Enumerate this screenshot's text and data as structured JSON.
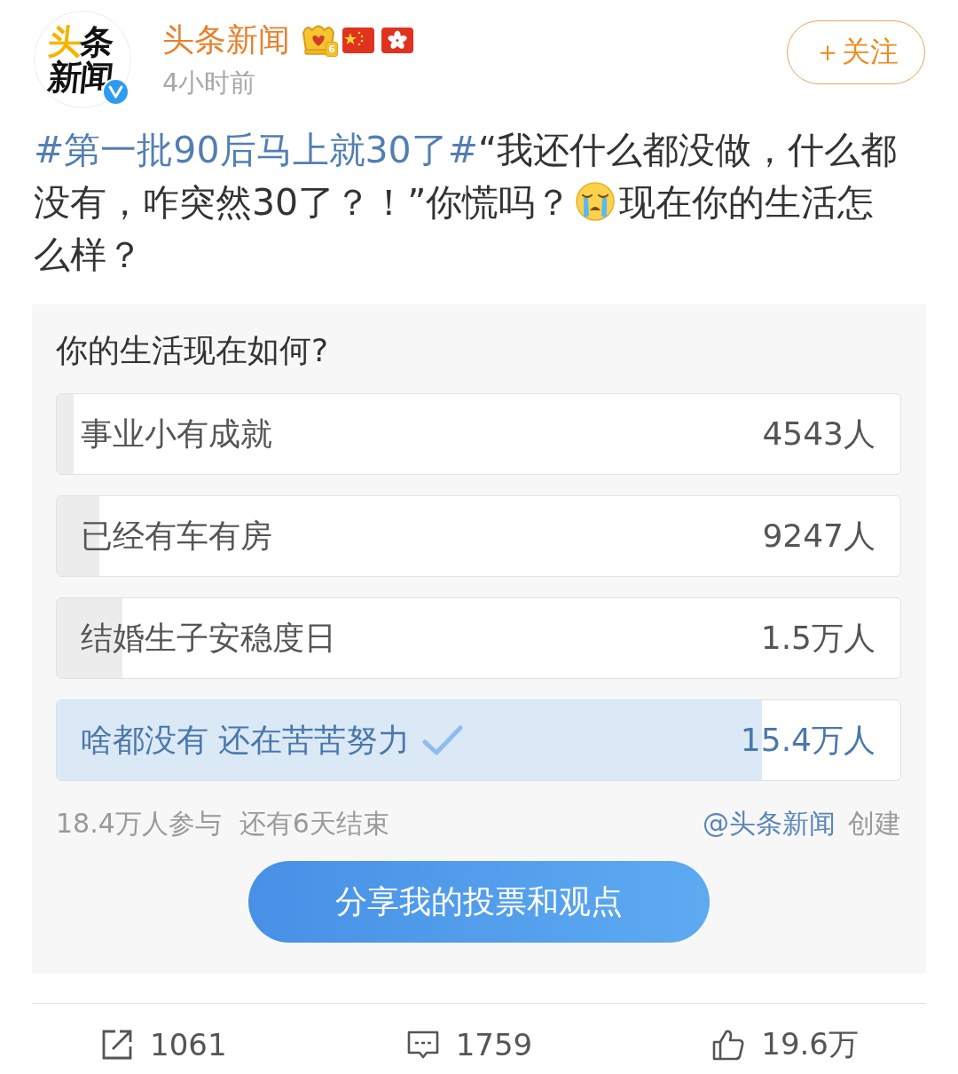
{
  "author": {
    "avatar_logo": [
      "头条",
      "新闻"
    ],
    "verified": true,
    "name": "头条新闻",
    "level_tag": "6",
    "time": "4小时前"
  },
  "follow_button": "＋关注",
  "post_text": [
    {
      "kind": "hashtag",
      "text": "#第一批90后马上就30了#"
    },
    {
      "kind": "text",
      "text": "“我还什么都没做，什么都没有，咋突然30了？！”你慌吗？"
    },
    {
      "kind": "emoji"
    },
    {
      "kind": "text",
      "text": "现在你的生活怎么样？"
    }
  ],
  "poll": {
    "question": "你的生活现在如何?",
    "options": [
      {
        "label": "事业小有成就",
        "count": "4543人",
        "level": 0.02,
        "selected": false
      },
      {
        "label": "已经有车有房",
        "count": "9247人",
        "level": 0.05,
        "selected": false
      },
      {
        "label": "结婚生子安稳度日",
        "count": "1.5万人",
        "level": 0.078,
        "selected": false
      },
      {
        "label": "啥都没有 还在苦苦努力",
        "count": "15.4万人",
        "level": 0.836,
        "selected": true
      }
    ],
    "participants": "18.4万人参与",
    "remaining": "还有6天结束",
    "creator": "@头条新闻",
    "creator_suffix": "创建",
    "share_button": "分享我的投票和观点"
  },
  "actions": [
    {
      "kind": "repost",
      "count": "1061"
    },
    {
      "kind": "comment",
      "count": "1759"
    },
    {
      "kind": "like",
      "count": "19.6万"
    }
  ]
}
